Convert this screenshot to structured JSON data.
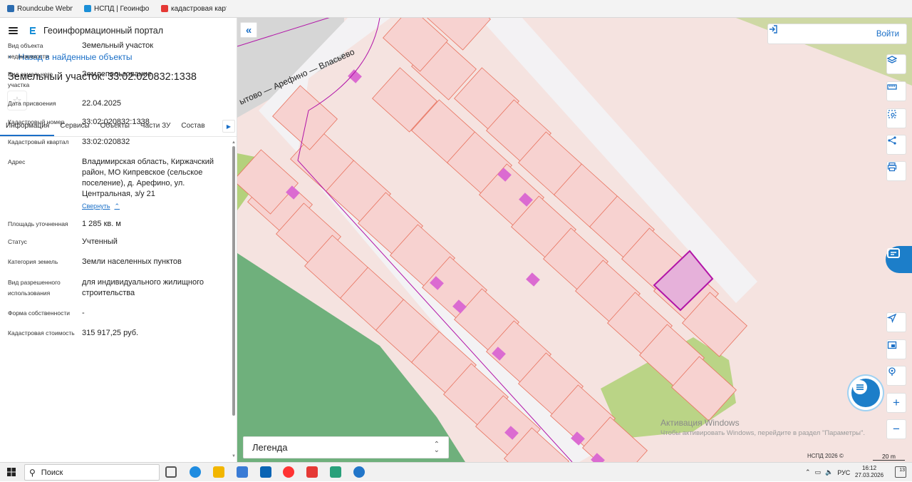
{
  "browser": {
    "bookmarks": [
      {
        "label": "Roundcube Webm",
        "color": "#2b6cb0"
      },
      {
        "label": "НСПД | Геоинфор",
        "color": "#1a8fd7"
      },
      {
        "label": "кадастровая карт",
        "color": "#e53935"
      }
    ]
  },
  "panel": {
    "portal_title": "Геоинформационный портал",
    "back_label": "Назад в найденные объекты",
    "object_title": "Земельный участок: 33:02:020832:1338",
    "tabs": [
      {
        "label": "Информация",
        "active": true
      },
      {
        "label": "Сервисы"
      },
      {
        "label": "Объекты"
      },
      {
        "label": "Части ЗУ"
      },
      {
        "label": "Состав"
      }
    ],
    "properties": [
      {
        "label": "Вид объекта недвижимости",
        "value": "Земельный участок"
      },
      {
        "label": "Вид земельного участка",
        "value": "Землепользование"
      },
      {
        "label": "Дата присвоения",
        "value": "22.04.2025"
      },
      {
        "label": "Кадастровый номер",
        "value": "33:02:020832:1338"
      },
      {
        "label": "Кадастровый квартал",
        "value": "33:02:020832"
      },
      {
        "label": "Адрес",
        "value": "Владимирская область, Киржачский район, МО Кипревское (сельское поселение), д. Арефино, ул. Центральная, з/у 21"
      },
      {
        "label": "Площадь уточненная",
        "value": "1 285 кв. м"
      },
      {
        "label": "Статус",
        "value": "Учтенный"
      },
      {
        "label": "Категория земель",
        "value": "Земли населенных пунктов"
      },
      {
        "label": "Вид разрешенного использования",
        "value": "для индивидуального жилищного строительства"
      },
      {
        "label": "Форма собственности",
        "value": "-"
      },
      {
        "label": "Кадастровая стоимость",
        "value": "315 917,25 руб."
      }
    ],
    "collapse_label": "Свернуть"
  },
  "map": {
    "road_label": "ытово — Арефино — Власьево",
    "login_label": "Войти",
    "legend_label": "Легенда",
    "watermark_title": "Активация Windows",
    "watermark_text": "Чтобы активировать Windows, перейдите в раздел \"Параметры\".",
    "attribution": "НСПД 2026 ©",
    "scale_label": "20 m",
    "toolbar_top": [
      "layers-icon",
      "ruler-icon",
      "select-area-icon",
      "share-icon",
      "print-icon"
    ],
    "toolbar_bottom": [
      "locate-icon",
      "overview-icon",
      "pin-icon",
      "zoom-in-icon",
      "zoom-out-icon"
    ],
    "colors": {
      "background": "#f5e3e0",
      "parcel_fill": "#f7d2d0",
      "parcel_stroke": "#e8735f",
      "road": "#f3f2f4",
      "building": "#db6bd1",
      "selected_fill": "#e6b1da",
      "selected_stroke": "#b215a8",
      "forest": "#6fb07c",
      "meadow": "#b4d17c",
      "urban": "#d6d6d6"
    }
  },
  "taskbar": {
    "search_label": "Поиск",
    "language": "РУС",
    "time": "16:12",
    "date": "27.03.2026",
    "notifications": "13"
  }
}
